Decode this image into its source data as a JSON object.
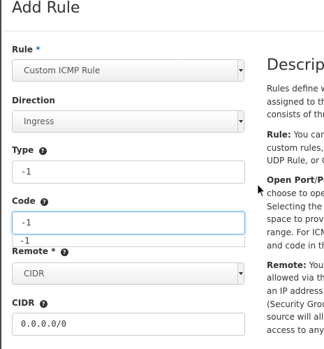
{
  "modal": {
    "title": "Add Rule"
  },
  "form": {
    "rule": {
      "label": "Rule",
      "required_mark": "*",
      "value": "Custom ICMP Rule"
    },
    "direction": {
      "label": "Direction",
      "value": "Ingress"
    },
    "type": {
      "label": "Type",
      "value": "-1"
    },
    "code": {
      "label": "Code",
      "value": "-1",
      "suggestion": "-1"
    },
    "remote": {
      "label": "Remote",
      "required_mark": "*",
      "value": "CIDR"
    },
    "cidr": {
      "label": "CIDR",
      "value": "0.0.0.0/0"
    }
  },
  "description": {
    "title": "Descript",
    "lines": [
      "Rules define w",
      "assigned to th",
      "consists of thr",
      "Rule:",
      " You can",
      "custom rules, ",
      "UDP Rule, or C",
      "Open Port",
      "/",
      "Po",
      "choose to ope",
      "Selecting the \"",
      "space to provi",
      "range. For ICM",
      "and code in th",
      "Remote:",
      " You",
      "allowed via thi",
      "an IP address",
      "(Security Grou",
      "source will allo",
      "access to any"
    ]
  },
  "colors": {
    "required": "#1a73c7",
    "focus_border": "#66afe9",
    "border": "#cccccc"
  },
  "icons": {
    "help": "question-circle-icon",
    "select_caret": "caret-down-icon",
    "cursor": "mouse-pointer-icon"
  }
}
